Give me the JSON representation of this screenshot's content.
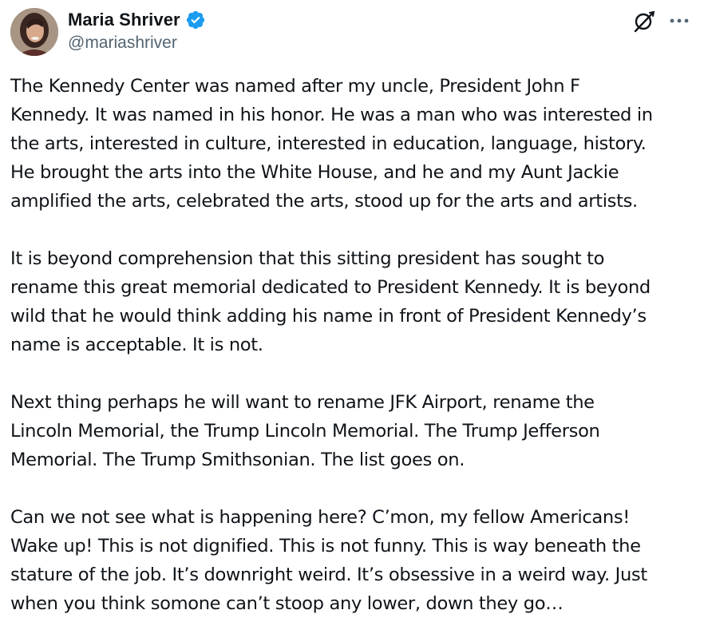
{
  "author": {
    "display_name": "Maria Shriver",
    "handle": "@mariashriver"
  },
  "icons": {
    "verified": "verified-badge-icon",
    "grok": "grok-icon",
    "more": "more-options-icon"
  },
  "colors": {
    "verified_blue": "#1d9bf0",
    "text_primary": "#0f1419",
    "text_secondary": "#536471"
  },
  "tweet": {
    "paragraphs": [
      {
        "lines": [
          "The Kennedy Center was named after my uncle, President John F",
          "Kennedy. It was named in his honor. He was a man who was interested in",
          "the arts, interested in culture, interested in education, language, history.",
          "He brought the arts into the White House, and he and my Aunt Jackie",
          "amplified the arts, celebrated the arts, stood up for the arts and artists."
        ]
      },
      {
        "lines": [
          "It is beyond comprehension that this sitting president has sought to",
          "rename this great memorial dedicated to President Kennedy. It is beyond",
          "wild that he would think adding his name in front of President Kennedy’s",
          "name is acceptable. It is not."
        ]
      },
      {
        "lines": [
          "Next thing perhaps he will want to rename JFK Airport, rename the",
          "Lincoln Memorial, the Trump Lincoln Memorial. The Trump Jefferson",
          "Memorial. The Trump Smithsonian. The list goes on."
        ]
      },
      {
        "lines": [
          "Can we not see what is happening here? C’mon, my fellow Americans!",
          "Wake up! This is not dignified. This is not funny. This is way beneath the",
          "stature of the job. It’s downright weird. It’s obsessive in a weird way. Just",
          "when you think somone can’t stoop any lower, down they go…"
        ]
      }
    ]
  }
}
